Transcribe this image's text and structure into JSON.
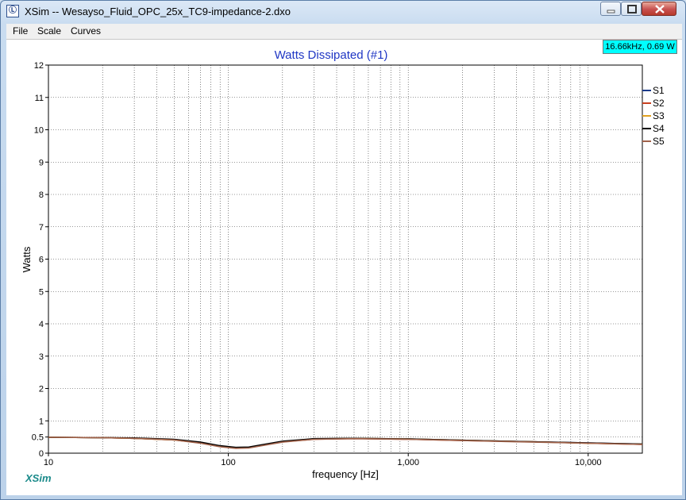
{
  "window": {
    "title": "XSim -- Wesayso_Fluid_OPC_25x_TC9-impedance-2.dxo",
    "icon": "xsim-app-icon"
  },
  "menu": [
    "File",
    "Scale",
    "Curves"
  ],
  "cursor_readout": "16.66kHz, 0.69 W",
  "brand": "XSim",
  "colors": {
    "title": "#1f36c4",
    "readout_bg": "#00ffff",
    "brand": "#1a8a8a"
  },
  "chart_data": {
    "type": "line",
    "title": "Watts Dissipated (#1)",
    "xlabel": "frequency [Hz]",
    "ylabel": "Watts",
    "xscale": "log",
    "xlim": [
      10,
      20000
    ],
    "ylim": [
      0,
      12
    ],
    "xticks": [
      10,
      100,
      1000,
      10000
    ],
    "xtick_labels": [
      "10",
      "100",
      "1,000",
      "10,000"
    ],
    "yticks": [
      0,
      0.5,
      1,
      2,
      3,
      4,
      5,
      6,
      7,
      8,
      9,
      10,
      11,
      12
    ],
    "ytick_labels": [
      "0",
      "0.5",
      "1",
      "2",
      "3",
      "4",
      "5",
      "6",
      "7",
      "8",
      "9",
      "10",
      "11",
      "12"
    ],
    "grid": true,
    "legend_position": "right",
    "x": [
      10,
      20,
      30,
      50,
      70,
      90,
      110,
      130,
      150,
      200,
      300,
      500,
      1000,
      2000,
      5000,
      10000,
      20000
    ],
    "series": [
      {
        "name": "S1",
        "color": "#1a3a8a",
        "values": [
          0.49,
          0.48,
          0.46,
          0.42,
          0.33,
          0.22,
          0.17,
          0.18,
          0.24,
          0.36,
          0.44,
          0.46,
          0.44,
          0.4,
          0.35,
          0.32,
          0.28
        ]
      },
      {
        "name": "S2",
        "color": "#c8401f",
        "values": [
          0.49,
          0.48,
          0.46,
          0.41,
          0.32,
          0.21,
          0.16,
          0.17,
          0.23,
          0.35,
          0.43,
          0.45,
          0.43,
          0.39,
          0.35,
          0.31,
          0.27
        ]
      },
      {
        "name": "S3",
        "color": "#e0a020",
        "values": [
          0.49,
          0.48,
          0.46,
          0.41,
          0.32,
          0.22,
          0.17,
          0.18,
          0.24,
          0.36,
          0.44,
          0.46,
          0.44,
          0.4,
          0.35,
          0.31,
          0.28
        ]
      },
      {
        "name": "S4",
        "color": "#000000",
        "values": [
          0.49,
          0.48,
          0.47,
          0.43,
          0.34,
          0.23,
          0.18,
          0.19,
          0.25,
          0.37,
          0.45,
          0.46,
          0.44,
          0.4,
          0.35,
          0.32,
          0.28
        ]
      },
      {
        "name": "S5",
        "color": "#a0624a",
        "values": [
          0.49,
          0.48,
          0.46,
          0.41,
          0.31,
          0.2,
          0.15,
          0.16,
          0.22,
          0.34,
          0.43,
          0.45,
          0.43,
          0.39,
          0.34,
          0.31,
          0.27
        ]
      }
    ]
  }
}
